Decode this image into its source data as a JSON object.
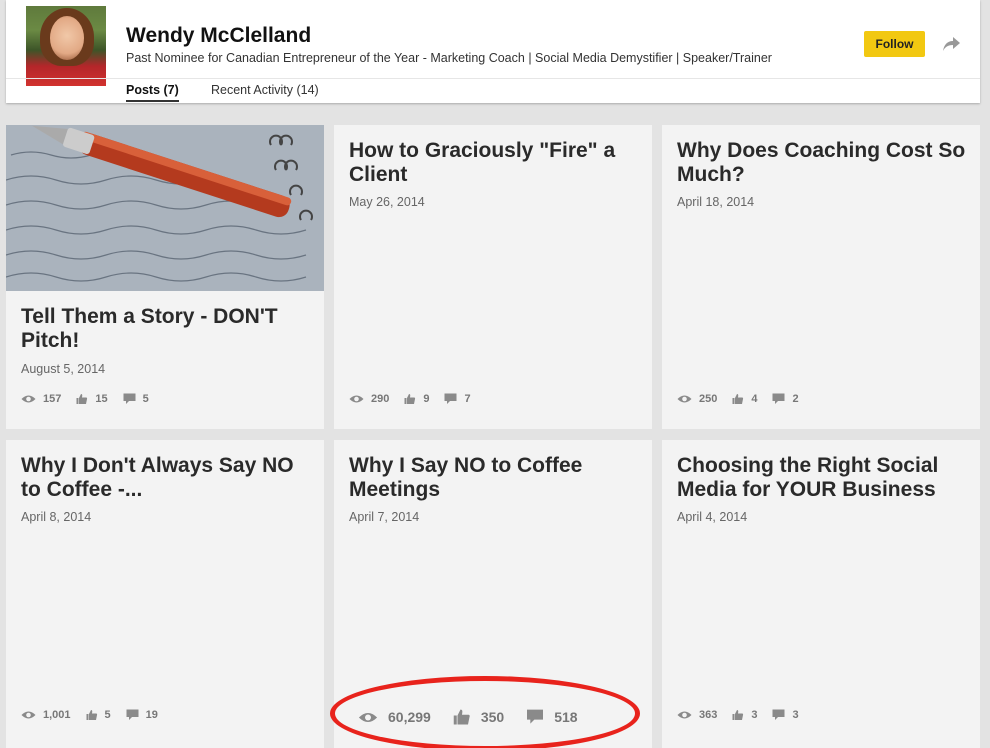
{
  "profile": {
    "name": "Wendy McClelland",
    "headline": "Past Nominee for Canadian Entrepreneur of the Year - Marketing Coach | Social Media Demystifier | Speaker/Trainer",
    "follow_label": "Follow"
  },
  "tabs": [
    {
      "label": "Posts (7)",
      "active": true
    },
    {
      "label": "Recent Activity (14)",
      "active": false
    }
  ],
  "posts": [
    {
      "title": "Tell Them a Story - DON'T Pitch!",
      "date": "August 5, 2014",
      "views": "157",
      "likes": "15",
      "comments": "5"
    },
    {
      "title": "How to Graciously \"Fire\" a Client",
      "date": "May 26, 2014",
      "views": "290",
      "likes": "9",
      "comments": "7"
    },
    {
      "title": "Why Does Coaching Cost So Much?",
      "date": "April 18, 2014",
      "views": "250",
      "likes": "4",
      "comments": "2"
    },
    {
      "title": "Why I Don't Always Say NO to Coffee -...",
      "date": "April 8, 2014",
      "views": "1,001",
      "likes": "5",
      "comments": "19"
    },
    {
      "title": "Why I Say NO to Coffee Meetings",
      "date": "April 7, 2014",
      "views": "60,299",
      "likes": "350",
      "comments": "518"
    },
    {
      "title": "Choosing the Right Social Media for YOUR Business",
      "date": "April 4, 2014",
      "views": "363",
      "likes": "3",
      "comments": "3"
    }
  ],
  "colors": {
    "follow": "#f2c811",
    "annotation": "#e8231c"
  },
  "icons": [
    "share-icon",
    "eye-icon",
    "thumbs-up-icon",
    "comment-icon"
  ]
}
